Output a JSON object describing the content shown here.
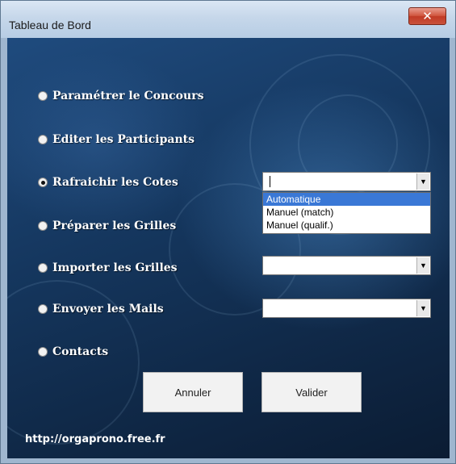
{
  "window": {
    "title": "Tableau de Bord",
    "close_glyph": "✕"
  },
  "options": [
    {
      "label": "Paramétrer le Concours",
      "checked": false
    },
    {
      "label": "Editer les Participants",
      "checked": false
    },
    {
      "label": "Rafraichir les Cotes",
      "checked": true
    },
    {
      "label": "Préparer les Grilles",
      "checked": false
    },
    {
      "label": "Importer les Grilles",
      "checked": false
    },
    {
      "label": "Envoyer les Mails",
      "checked": false
    },
    {
      "label": "Contacts",
      "checked": false
    }
  ],
  "combos": {
    "cotes": {
      "value": ""
    },
    "importer": {
      "value": ""
    },
    "envoyer": {
      "value": ""
    }
  },
  "cotes_list": {
    "items": [
      "Automatique",
      "Manuel (match)",
      "Manuel (qualif.)"
    ],
    "selected_index": 0
  },
  "buttons": {
    "cancel_label": "Annuler",
    "ok_label": "Valider"
  },
  "footer": {
    "url": "http://orgaprono.free.fr"
  },
  "colors": {
    "background": "#15375f",
    "list_selection": "#3a78d6",
    "close_button": "#c9533c"
  }
}
